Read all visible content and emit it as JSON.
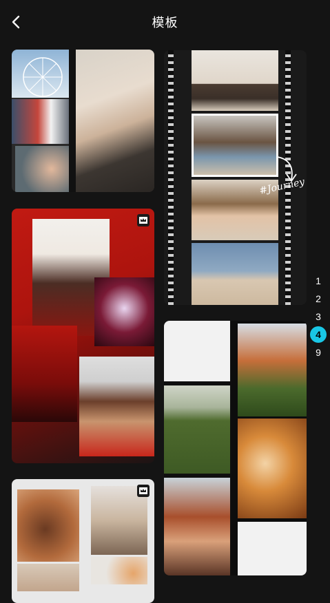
{
  "header": {
    "title": "模板",
    "back_icon": "chevron-left-icon"
  },
  "templates": [
    {
      "id": "ferris-collage",
      "premium": false
    },
    {
      "id": "film-strip-journey",
      "premium": false,
      "overlay_text": "#Journey"
    },
    {
      "id": "red-fashion-collage",
      "premium": true
    },
    {
      "id": "film-grass-collage",
      "premium": false
    },
    {
      "id": "leaf-film-collage",
      "premium": true
    }
  ],
  "pagination": {
    "pages": [
      "1",
      "2",
      "3",
      "4",
      "9"
    ],
    "active": "4"
  },
  "colors": {
    "background": "#141414",
    "accent": "#19c7e6"
  }
}
